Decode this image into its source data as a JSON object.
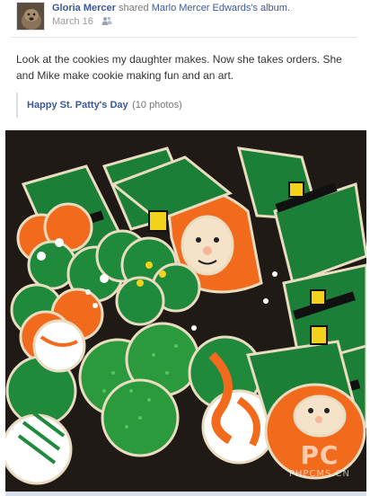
{
  "post": {
    "author": "Gloria Mercer",
    "action": "shared",
    "album_owner": "Marlo Mercer Edwards's album.",
    "date": "March 16",
    "audience_icon": "friends-icon",
    "text": "Look at the cookies my daughter makes. Now she takes orders. She and Mike make cookie making fun and an art."
  },
  "album": {
    "title": "Happy St. Patty's Day",
    "count": "(10 photos)"
  },
  "photo": {
    "watermark_logo": "PC",
    "watermark_text": "PHPCMS.CN"
  },
  "colors": {
    "link": "#3b5998",
    "green": "#1f8a3b",
    "orange": "#f26b1d",
    "background": "#1f1a16"
  }
}
